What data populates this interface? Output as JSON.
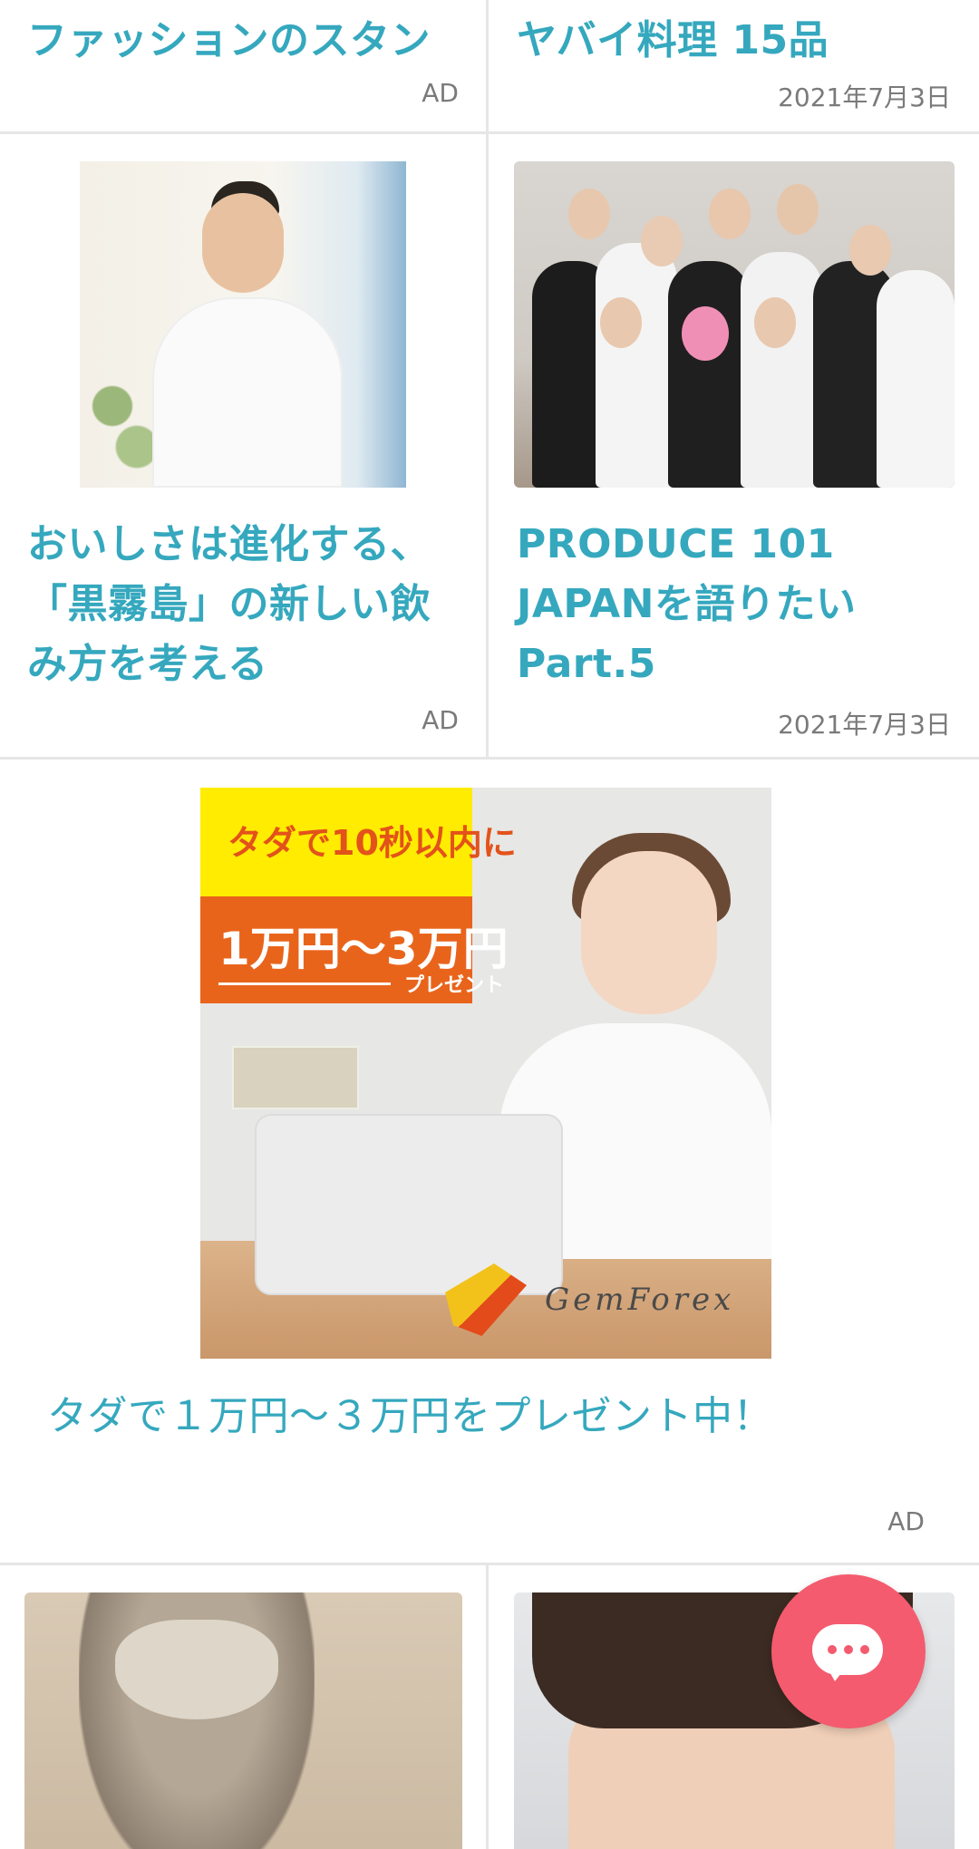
{
  "cards": {
    "top_left": {
      "title": "ファッションのスタン",
      "meta": "AD"
    },
    "top_right": {
      "title": "ヤバイ料理 15品",
      "meta": "2021年7月3日"
    },
    "mid_left": {
      "title": "おいしさは進化する、「黒霧島」の新しい飲み方を考える",
      "meta": "AD"
    },
    "mid_right": {
      "title": "PRODUCE 101 JAPANを語りたい　Part.5",
      "meta": "2021年7月3日"
    },
    "ad_banner": {
      "headline1": "タダで10秒以内に",
      "headline2": "1万円〜3万円",
      "headline3": "プレゼント",
      "brand": "GemForex",
      "title": "タダで１万円〜３万円をプレゼント中！",
      "meta": "AD"
    }
  },
  "fab": {
    "icon": "chat-bubble-icon"
  },
  "colors": {
    "link": "#35a8be",
    "fab": "#f45b6e",
    "divider": "#e6e6e6"
  }
}
